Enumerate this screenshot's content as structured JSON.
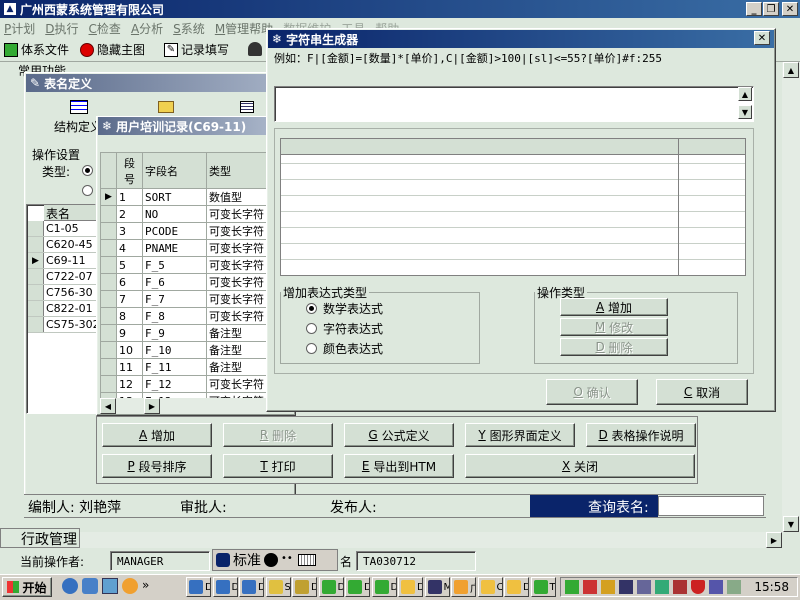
{
  "app": {
    "title": "广州西蒙系统管理有限公司"
  },
  "menu": [
    {
      "key": "P",
      "label": "计划"
    },
    {
      "key": "D",
      "label": "执行"
    },
    {
      "key": "C",
      "label": "检查"
    },
    {
      "key": "A",
      "label": "分析"
    },
    {
      "key": "S",
      "label": "系统"
    },
    {
      "key": "M",
      "label": "管理帮助"
    },
    {
      "key": "",
      "label": "数据维护"
    },
    {
      "key": "",
      "label": "工具"
    },
    {
      "key": "",
      "label": "帮助"
    }
  ],
  "toolbar": {
    "items": [
      "体系文件",
      "隐藏主图",
      "记录填写"
    ]
  },
  "left_panel_label": "常用功能",
  "table_def": {
    "title": "表名定义",
    "structure_label": "结构定义",
    "op_settings": "操作设置",
    "type_label": "类型:",
    "col_header": "表名",
    "rows": [
      "C1-05",
      "C620-45",
      "C69-11",
      "C722-07",
      "C756-30",
      "C822-01",
      "CS75-302"
    ],
    "selected_row": 2
  },
  "user_training": {
    "title": "用户培训记录(C69-11)",
    "headers": [
      "段号",
      "字段名",
      "类型"
    ],
    "rows": [
      [
        "1",
        "SORT",
        "数值型"
      ],
      [
        "2",
        "NO",
        "可变长字符"
      ],
      [
        "3",
        "PCODE",
        "可变长字符"
      ],
      [
        "4",
        "PNAME",
        "可变长字符"
      ],
      [
        "5",
        "F_5",
        "可变长字符"
      ],
      [
        "6",
        "F_6",
        "可变长字符"
      ],
      [
        "7",
        "F_7",
        "可变长字符"
      ],
      [
        "8",
        "F_8",
        "可变长字符"
      ],
      [
        "9",
        "F_9",
        "备注型"
      ],
      [
        "10",
        "F_10",
        "备注型"
      ],
      [
        "11",
        "F_11",
        "备注型"
      ],
      [
        "12",
        "F_12",
        "可变长字符"
      ],
      [
        "13",
        "F_13",
        "可变长字符"
      ]
    ]
  },
  "bottom_buttons": {
    "row1": [
      {
        "key": "A",
        "label": "增加"
      },
      {
        "key": "R",
        "label": "删除",
        "disabled": true
      },
      {
        "key": "G",
        "label": "公式定义"
      },
      {
        "key": "Y",
        "label": "图形界面定义"
      },
      {
        "key": "D",
        "label": "表格操作说明"
      }
    ],
    "row2": [
      {
        "key": "P",
        "label": "段号排序"
      },
      {
        "key": "T",
        "label": "打印"
      },
      {
        "key": "E",
        "label": "导出到HTM"
      },
      {
        "key": "X",
        "label": "关闭"
      }
    ]
  },
  "info_bar": {
    "editor": "编制人:  刘艳萍",
    "approver": "审批人:",
    "publisher": "发布人:",
    "query": "查询表名:"
  },
  "dialog": {
    "title": "字符串生成器",
    "example": "例如：F|[金额]=[数量]*[单价],C|[金额]>100|[sl]<=55?[单价]#f:255",
    "expr_group": "增加表达式类型",
    "expr_options": [
      "数学表达式",
      "字符表达式",
      "颜色表达式"
    ],
    "selected_expr": 0,
    "op_group": "操作类型",
    "op_buttons": [
      {
        "key": "A",
        "label": "增加",
        "disabled": false
      },
      {
        "key": "M",
        "label": "修改",
        "disabled": true
      },
      {
        "key": "D",
        "label": "删除",
        "disabled": true
      }
    ],
    "ok": {
      "key": "O",
      "label": "确认"
    },
    "cancel": {
      "key": "C",
      "label": "取消"
    }
  },
  "admin_label": "行政管理",
  "status": {
    "op_label": "当前操作者:",
    "operator": "MANAGER",
    "ime": "标准",
    "name_label": "名",
    "code": "TA030712"
  },
  "taskbar": {
    "start": "开始",
    "clock": "15:58",
    "tasks": [
      "D",
      "D",
      "D",
      "S",
      "D",
      "D",
      "D",
      "D",
      "D",
      "M",
      "广",
      "C",
      "D",
      "T"
    ]
  }
}
